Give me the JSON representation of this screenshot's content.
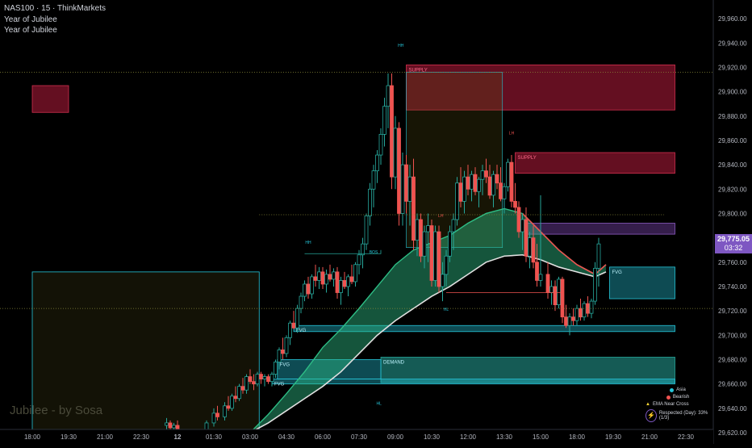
{
  "header": {
    "symbol_line": "NAS100 · 15 · ThinkMarkets",
    "indicator_1": "Year of Jubilee",
    "indicator_2": "Year of Jubilee"
  },
  "watermark": "Jubilee - by Sosa",
  "price_badge": {
    "price": "29,775.05",
    "countdown": "03:32"
  },
  "legend": {
    "items": [
      {
        "label": "Asia",
        "color": "#26c6da"
      },
      {
        "label": "Bearish",
        "color": "#ef5350"
      },
      {
        "label": "EMA Near Cross",
        "color": "#fdd835"
      },
      {
        "label": "Respected (Day): 33% (1/3)",
        "color": "#7e57c2"
      }
    ]
  },
  "colors": {
    "up": "#26a69a",
    "down": "#ef5350",
    "supply": "#b71c3c",
    "demand": "#26a69a",
    "fvg": "#26c6da",
    "ema_fast": "#2ebd85",
    "ema_slow": "#e0e0e0",
    "badge": "#7e57c2"
  },
  "chart_data": {
    "type": "candlestick",
    "title": "NAS100 · 15 · ThinkMarkets",
    "ylim": [
      29620,
      29970
    ],
    "y_ticks": [
      "29,960.00",
      "29,940.00",
      "29,920.00",
      "29,900.00",
      "29,880.00",
      "29,860.00",
      "29,840.00",
      "29,820.00",
      "29,800.00",
      "29,780.00",
      "29,760.00",
      "29,740.00",
      "29,720.00",
      "29,700.00",
      "29,680.00",
      "29,660.00",
      "29,640.00",
      "29,620.00"
    ],
    "x_ticks": [
      "18:00",
      "19:30",
      "21:00",
      "22:30",
      "12",
      "01:30",
      "03:00",
      "04:30",
      "06:00",
      "07:30",
      "09:00",
      "10:30",
      "12:00",
      "13:30",
      "15:00",
      "18:00",
      "19:30",
      "21:00",
      "22:30"
    ],
    "zones": [
      {
        "label": "",
        "kind": "supply",
        "y0": 29883,
        "y1": 29905,
        "x0": 0,
        "x1": 1
      },
      {
        "label": "SUPPLY",
        "kind": "supply",
        "y0": 29885,
        "y1": 29922,
        "x0": 10.3,
        "x1": 17.7
      },
      {
        "label": "SUPPLY",
        "kind": "supply",
        "y0": 29833,
        "y1": 29850,
        "x0": 13.3,
        "x1": 17.7
      },
      {
        "label": "",
        "kind": "purple",
        "y0": 29783,
        "y1": 29792,
        "x0": 13.6,
        "x1": 17.7
      },
      {
        "label": "FVG",
        "kind": "fvg",
        "y0": 29730,
        "y1": 29756,
        "x0": 15.9,
        "x1": 17.7
      },
      {
        "label": "FVG",
        "kind": "fvg",
        "y0": 29703,
        "y1": 29708,
        "x0": 7.2,
        "x1": 17.7
      },
      {
        "label": "DEMAND",
        "kind": "demand",
        "y0": 29661,
        "y1": 29682,
        "x0": 9.6,
        "x1": 17.7
      },
      {
        "label": "FVG",
        "kind": "fvg",
        "y0": 29664,
        "y1": 29680,
        "x0": 6.75,
        "x1": 9.6
      },
      {
        "label": "FVG",
        "kind": "fvg",
        "y0": 29660,
        "y1": 29664,
        "x0": 6.6,
        "x1": 17.7
      },
      {
        "label": "",
        "kind": "asia",
        "y0": 29620,
        "y1": 29752,
        "x0": 0,
        "x1": 6.25
      }
    ],
    "structure_labels": [
      {
        "label": "HH",
        "t": 10.15,
        "y": 29937
      },
      {
        "label": "LH",
        "t": 13.2,
        "y": 29865
      },
      {
        "label": "HH",
        "t": 7.6,
        "y": 29775
      },
      {
        "label": "LH",
        "t": 11.25,
        "y": 29797
      },
      {
        "label": "HL",
        "t": 11.4,
        "y": 29720
      },
      {
        "label": "HL",
        "t": 9.55,
        "y": 29643
      },
      {
        "label": "BOS",
        "t": 9.4,
        "y": 29767
      }
    ],
    "series": [
      {
        "name": "price",
        "ohlc_note": "15-minute candles"
      }
    ],
    "candles": [
      [
        3.7,
        29626,
        29632,
        29620,
        29628
      ],
      [
        3.8,
        29628,
        29630,
        29622,
        29624
      ],
      [
        3.9,
        29624,
        29628,
        29620,
        29626
      ],
      [
        4.0,
        29626,
        29630,
        29620,
        29622
      ],
      [
        4.8,
        29620,
        29630,
        29620,
        29628
      ],
      [
        5.0,
        29628,
        29640,
        29625,
        29636
      ],
      [
        5.1,
        29636,
        29642,
        29630,
        29633
      ],
      [
        5.3,
        29633,
        29645,
        29630,
        29642
      ],
      [
        5.4,
        29642,
        29650,
        29638,
        29640
      ],
      [
        5.5,
        29640,
        29652,
        29638,
        29650
      ],
      [
        5.6,
        29650,
        29658,
        29645,
        29648
      ],
      [
        5.7,
        29648,
        29660,
        29646,
        29658
      ],
      [
        5.8,
        29658,
        29665,
        29652,
        29655
      ],
      [
        5.9,
        29655,
        29668,
        29652,
        29666
      ],
      [
        6.0,
        29666,
        29672,
        29660,
        29662
      ],
      [
        6.1,
        29662,
        29668,
        29655,
        29660
      ],
      [
        6.2,
        29660,
        29670,
        29658,
        29668
      ],
      [
        6.3,
        29668,
        29670,
        29660,
        29664
      ],
      [
        6.4,
        29664,
        29668,
        29658,
        29666
      ],
      [
        6.5,
        29666,
        29668,
        29660,
        29662
      ],
      [
        6.6,
        29662,
        29670,
        29658,
        29668
      ],
      [
        6.7,
        29668,
        29680,
        29665,
        29678
      ],
      [
        6.8,
        29678,
        29690,
        29672,
        29688
      ],
      [
        6.9,
        29688,
        29698,
        29680,
        29685
      ],
      [
        7.0,
        29685,
        29700,
        29682,
        29698
      ],
      [
        7.1,
        29698,
        29712,
        29692,
        29710
      ],
      [
        7.2,
        29710,
        29720,
        29705,
        29706
      ],
      [
        7.3,
        29706,
        29725,
        29702,
        29722
      ],
      [
        7.4,
        29722,
        29735,
        29718,
        29732
      ],
      [
        7.5,
        29732,
        29745,
        29728,
        29742
      ],
      [
        7.6,
        29742,
        29748,
        29730,
        29734
      ],
      [
        7.7,
        29734,
        29750,
        29730,
        29748
      ],
      [
        7.8,
        29748,
        29758,
        29740,
        29745
      ],
      [
        7.9,
        29745,
        29756,
        29738,
        29752
      ],
      [
        8.0,
        29752,
        29756,
        29738,
        29742
      ],
      [
        8.1,
        29742,
        29754,
        29735,
        29750
      ],
      [
        8.2,
        29750,
        29758,
        29744,
        29746
      ],
      [
        8.3,
        29746,
        29755,
        29740,
        29752
      ],
      [
        8.4,
        29752,
        29756,
        29730,
        29735
      ],
      [
        8.5,
        29735,
        29748,
        29725,
        29745
      ],
      [
        8.6,
        29745,
        29752,
        29738,
        29740
      ],
      [
        8.7,
        29740,
        29750,
        29732,
        29748
      ],
      [
        8.8,
        29748,
        29758,
        29742,
        29744
      ],
      [
        8.9,
        29744,
        29760,
        29740,
        29758
      ],
      [
        9.0,
        29758,
        29770,
        29750,
        29766
      ],
      [
        9.1,
        29766,
        29780,
        29755,
        29775
      ],
      [
        9.2,
        29775,
        29800,
        29770,
        29798
      ],
      [
        9.3,
        29798,
        29825,
        29790,
        29820
      ],
      [
        9.4,
        29820,
        29840,
        29805,
        29835
      ],
      [
        9.5,
        29835,
        29852,
        29825,
        29848
      ],
      [
        9.6,
        29848,
        29870,
        29840,
        29865
      ],
      [
        9.7,
        29865,
        29895,
        29855,
        29888
      ],
      [
        9.8,
        29888,
        29915,
        29870,
        29905
      ],
      [
        9.9,
        29905,
        29915,
        29820,
        29830
      ],
      [
        10.0,
        29830,
        29880,
        29820,
        29870
      ],
      [
        10.1,
        29870,
        29875,
        29790,
        29800
      ],
      [
        10.2,
        29800,
        29850,
        29790,
        29840
      ],
      [
        10.3,
        29840,
        29848,
        29800,
        29810
      ],
      [
        10.4,
        29810,
        29840,
        29790,
        29830
      ],
      [
        10.5,
        29830,
        29845,
        29770,
        29778
      ],
      [
        10.6,
        29778,
        29800,
        29765,
        29795
      ],
      [
        10.7,
        29795,
        29800,
        29760,
        29765
      ],
      [
        10.8,
        29765,
        29790,
        29755,
        29785
      ],
      [
        10.9,
        29785,
        29800,
        29760,
        29790
      ],
      [
        11.0,
        29790,
        29795,
        29740,
        29745
      ],
      [
        11.1,
        29745,
        29790,
        29740,
        29785
      ],
      [
        11.2,
        29785,
        29790,
        29735,
        29740
      ],
      [
        11.3,
        29740,
        29760,
        29728,
        29750
      ],
      [
        11.4,
        29750,
        29770,
        29740,
        29765
      ],
      [
        11.5,
        29765,
        29790,
        29760,
        29785
      ],
      [
        11.6,
        29785,
        29800,
        29770,
        29795
      ],
      [
        11.7,
        29795,
        29830,
        29790,
        29825
      ],
      [
        11.8,
        29825,
        29838,
        29805,
        29810
      ],
      [
        11.9,
        29810,
        29835,
        29800,
        29830
      ],
      [
        12.0,
        29830,
        29840,
        29815,
        29820
      ],
      [
        12.1,
        29820,
        29835,
        29810,
        29832
      ],
      [
        12.2,
        29832,
        29838,
        29815,
        29818
      ],
      [
        12.3,
        29818,
        29830,
        29805,
        29828
      ],
      [
        12.4,
        29828,
        29840,
        29815,
        29835
      ],
      [
        12.5,
        29835,
        29845,
        29825,
        29830
      ],
      [
        12.6,
        29830,
        29840,
        29812,
        29815
      ],
      [
        12.7,
        29815,
        29835,
        29805,
        29832
      ],
      [
        12.8,
        29832,
        29840,
        29820,
        29825
      ],
      [
        12.9,
        29825,
        29838,
        29810,
        29812
      ],
      [
        13.0,
        29812,
        29825,
        29800,
        29822
      ],
      [
        13.1,
        29822,
        29845,
        29818,
        29842
      ],
      [
        13.2,
        29842,
        29848,
        29805,
        29810
      ],
      [
        13.3,
        29810,
        29825,
        29800,
        29805
      ],
      [
        13.4,
        29805,
        29810,
        29780,
        29785
      ],
      [
        13.5,
        29785,
        29800,
        29770,
        29795
      ],
      [
        13.6,
        29795,
        29805,
        29760,
        29765
      ],
      [
        13.7,
        29765,
        29785,
        29755,
        29780
      ],
      [
        13.8,
        29780,
        29790,
        29755,
        29760
      ],
      [
        13.9,
        29760,
        29775,
        29740,
        29745
      ],
      [
        14.0,
        29745,
        29815,
        29740,
        29750
      ],
      [
        14.2,
        29750,
        29760,
        29730,
        29735
      ],
      [
        14.3,
        29735,
        29745,
        29725,
        29740
      ],
      [
        14.4,
        29740,
        29745,
        29720,
        29725
      ],
      [
        14.5,
        29725,
        29748,
        29722,
        29746
      ],
      [
        14.6,
        29746,
        29748,
        29710,
        29715
      ],
      [
        14.7,
        29715,
        29725,
        29706,
        29708
      ],
      [
        14.8,
        29708,
        29718,
        29700,
        29715
      ],
      [
        14.9,
        29715,
        29722,
        29708,
        29712
      ],
      [
        15.0,
        29712,
        29725,
        29708,
        29722
      ],
      [
        15.1,
        29722,
        29730,
        29712,
        29715
      ],
      [
        15.2,
        29715,
        29728,
        29712,
        29726
      ],
      [
        15.3,
        29726,
        29732,
        29715,
        29718
      ],
      [
        15.4,
        29718,
        29730,
        29714,
        29728
      ],
      [
        15.5,
        29728,
        29760,
        29725,
        29755
      ],
      [
        15.6,
        29755,
        29780,
        29740,
        29775
      ]
    ],
    "ema_fast": [
      [
        6.0,
        29620
      ],
      [
        6.5,
        29635
      ],
      [
        7.0,
        29652
      ],
      [
        7.5,
        29670
      ],
      [
        8.0,
        29690
      ],
      [
        8.5,
        29705
      ],
      [
        9.0,
        29722
      ],
      [
        9.5,
        29740
      ],
      [
        10.0,
        29758
      ],
      [
        10.5,
        29770
      ],
      [
        11.0,
        29776
      ],
      [
        11.5,
        29782
      ],
      [
        12.0,
        29792
      ],
      [
        12.5,
        29800
      ],
      [
        13.0,
        29804
      ],
      [
        13.5,
        29800
      ],
      [
        14.0,
        29785
      ],
      [
        14.5,
        29770
      ],
      [
        15.0,
        29758
      ],
      [
        15.5,
        29750
      ],
      [
        15.8,
        29758
      ]
    ],
    "ema_slow": [
      [
        6.0,
        29620
      ],
      [
        6.5,
        29628
      ],
      [
        7.0,
        29638
      ],
      [
        7.5,
        29648
      ],
      [
        8.0,
        29658
      ],
      [
        8.5,
        29670
      ],
      [
        9.0,
        29685
      ],
      [
        9.5,
        29700
      ],
      [
        10.0,
        29712
      ],
      [
        10.5,
        29722
      ],
      [
        11.0,
        29732
      ],
      [
        11.5,
        29740
      ],
      [
        12.0,
        29750
      ],
      [
        12.5,
        29760
      ],
      [
        13.0,
        29765
      ],
      [
        13.5,
        29766
      ],
      [
        14.0,
        29762
      ],
      [
        14.5,
        29756
      ],
      [
        15.0,
        29752
      ],
      [
        15.5,
        29748
      ],
      [
        15.8,
        29752
      ]
    ]
  }
}
